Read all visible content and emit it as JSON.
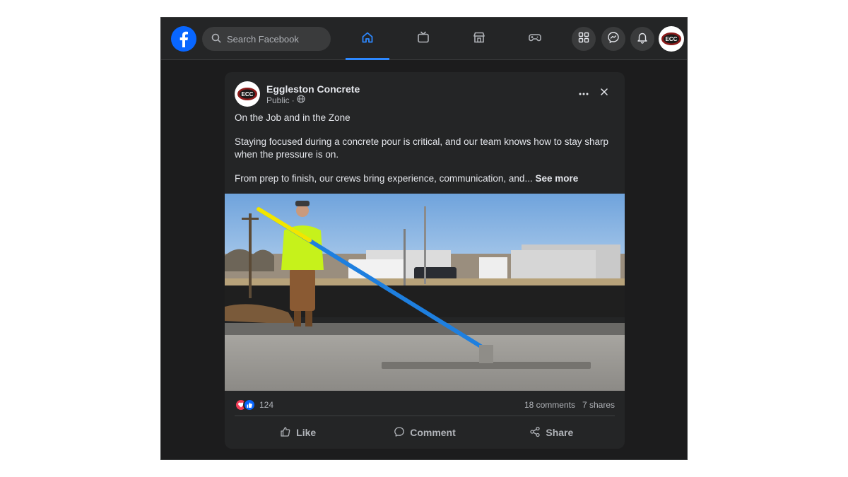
{
  "header": {
    "search": {
      "placeholder": "Search Facebook"
    },
    "tabs": [
      {
        "icon": "home-icon",
        "active": true
      },
      {
        "icon": "video-icon",
        "active": false
      },
      {
        "icon": "marketplace-icon",
        "active": false
      },
      {
        "icon": "gaming-icon",
        "active": false
      }
    ],
    "right_buttons": [
      "menu-grid-icon",
      "messenger-icon",
      "bell-icon"
    ],
    "profile_logo_text": "ECC"
  },
  "post": {
    "author": "Eggleston Concrete",
    "visibility": "Public",
    "separator": "·",
    "avatar_logo_text": "ECC",
    "text": {
      "title_line": "On the Job and in the Zone",
      "paragraph1": "Staying focused during a concrete pour is critical, and our team knows how to stay sharp when the pressure is on.",
      "paragraph2": "From prep to finish, our crews bring experience, communication, and... ",
      "see_more": "See more"
    },
    "stats": {
      "reaction_count": "124",
      "comments": "18 comments",
      "shares": "7 shares"
    },
    "actions": {
      "like": "Like",
      "comment": "Comment",
      "share": "Share"
    }
  },
  "colors": {
    "accent": "#2d88ff",
    "facebook_blue": "#0866ff",
    "love_red": "#f33e58",
    "page_bg": "#1c1c1d",
    "card_bg": "#242526"
  }
}
